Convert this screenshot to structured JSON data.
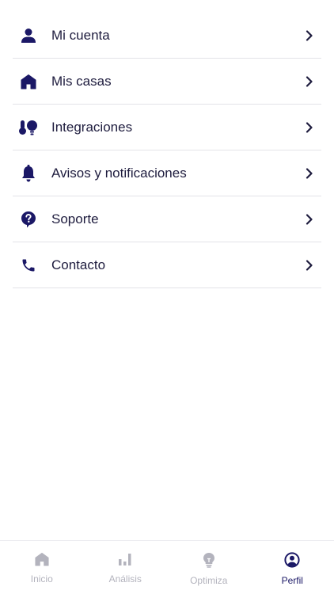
{
  "colors": {
    "primary": "#1b1866",
    "text": "#1e1c3e",
    "divider": "#e3e3e8",
    "inactive": "#b3b3bd"
  },
  "menu": {
    "items": [
      {
        "label": "Mi cuenta",
        "icon": "person-icon"
      },
      {
        "label": "Mis casas",
        "icon": "home-icon"
      },
      {
        "label": "Integraciones",
        "icon": "thermometer-bulb-icon"
      },
      {
        "label": "Avisos y notificaciones",
        "icon": "bell-icon"
      },
      {
        "label": "Soporte",
        "icon": "help-bubble-icon"
      },
      {
        "label": "Contacto",
        "icon": "phone-icon"
      }
    ]
  },
  "tabbar": {
    "tabs": [
      {
        "label": "Inicio",
        "icon": "home-icon",
        "active": false
      },
      {
        "label": "Análisis",
        "icon": "bar-chart-icon",
        "active": false
      },
      {
        "label": "Optimiza",
        "icon": "lightbulb-icon",
        "active": false
      },
      {
        "label": "Perfil",
        "icon": "profile-circle-icon",
        "active": true
      }
    ]
  }
}
